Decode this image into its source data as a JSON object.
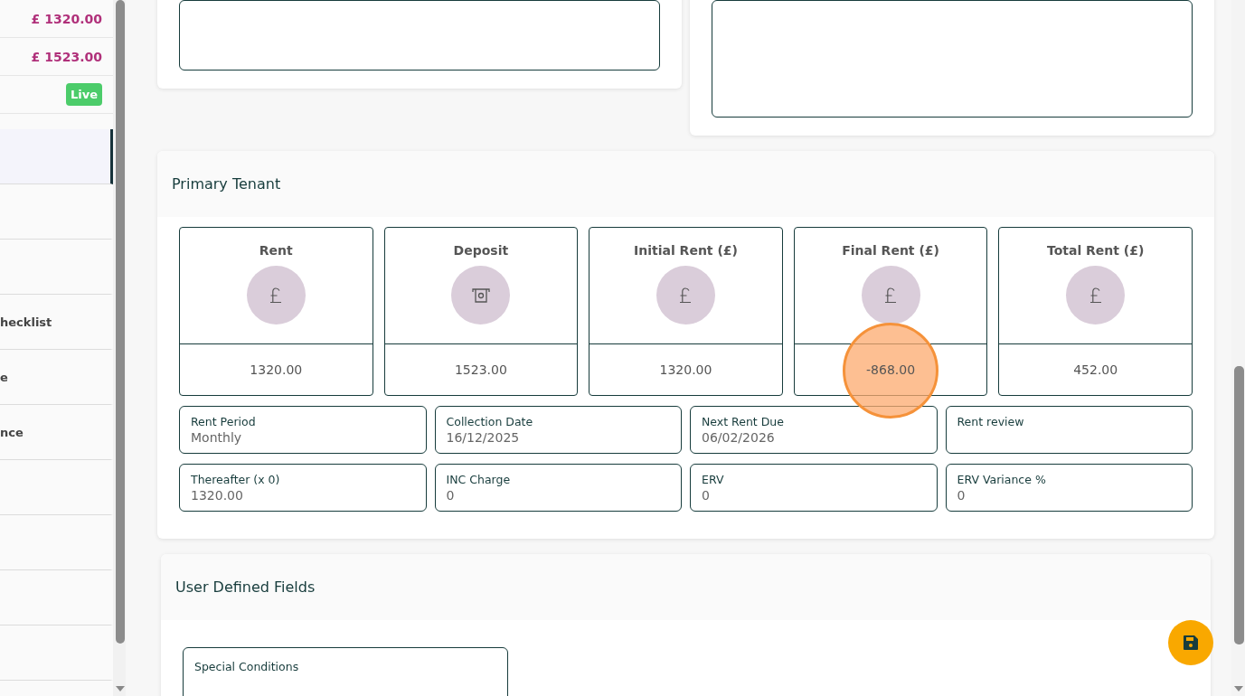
{
  "sidebar": {
    "summary": [
      {
        "kind": "amount",
        "text": "£ 1320.00"
      },
      {
        "kind": "amount",
        "text": "£ 1523.00"
      },
      {
        "kind": "badge",
        "text": "Live"
      }
    ],
    "items": [
      {
        "selected": true
      },
      {
        "selected": false
      },
      {
        "selected": false
      },
      {
        "label": "hecklist",
        "selected": false
      },
      {
        "label": "e",
        "selected": false
      },
      {
        "label": "nce",
        "selected": false
      },
      {
        "selected": false
      },
      {
        "selected": false
      },
      {
        "selected": false
      },
      {
        "selected": false
      }
    ]
  },
  "primary_tenant": {
    "title": "Primary Tenant",
    "stats": [
      {
        "title": "Rent",
        "kind": "pound",
        "value": "1320.00",
        "highlighted": false
      },
      {
        "title": "Deposit",
        "kind": "cash",
        "value": "1523.00",
        "highlighted": false
      },
      {
        "title": "Initial Rent (£)",
        "kind": "pound",
        "value": "1320.00",
        "highlighted": false
      },
      {
        "title": "Final Rent (£)",
        "kind": "pound",
        "value": "-868.00",
        "highlighted": true
      },
      {
        "title": "Total Rent (£)",
        "kind": "pound",
        "value": "452.00",
        "highlighted": false
      }
    ],
    "fields": [
      {
        "label": "Rent Period",
        "value": "Monthly"
      },
      {
        "label": "Collection Date",
        "value": "16/12/2025"
      },
      {
        "label": "Next Rent Due",
        "value": "06/02/2026"
      },
      {
        "label": "Rent review"
      },
      {
        "label": "Thereafter (x 0)",
        "value": "1320.00"
      },
      {
        "label": "INC Charge",
        "value": "0"
      },
      {
        "label": "ERV",
        "value": "0"
      },
      {
        "label": "ERV Variance %",
        "value": "0"
      }
    ]
  },
  "user_defined_fields": {
    "title": "User Defined Fields",
    "fields": [
      {
        "label": "Special Conditions"
      }
    ]
  }
}
